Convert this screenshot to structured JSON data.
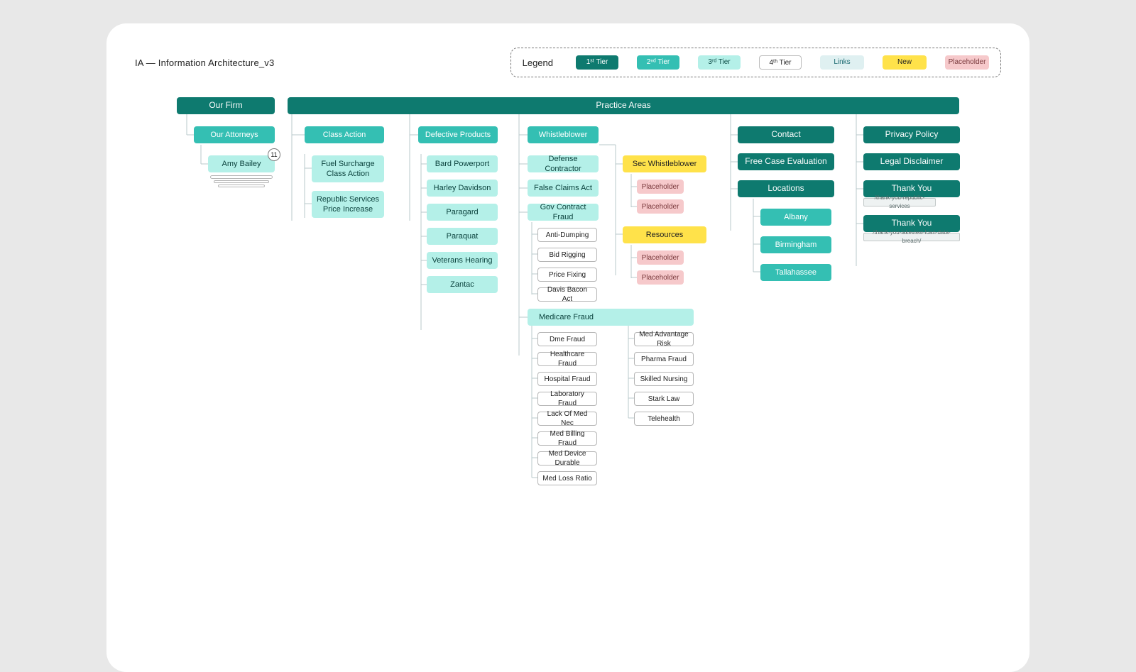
{
  "title": "IA — Information Architecture_v3",
  "legend": {
    "label": "Legend",
    "tier1": "1ˢᵗ Tier",
    "tier2": "2ⁿᵈ Tier",
    "tier3": "3ʳᵈ Tier",
    "tier4": "4ᵗʰ Tier",
    "links": "Links",
    "new": "New",
    "placeholder": "Placeholder"
  },
  "our_firm": "Our Firm",
  "our_attorneys": "Our Attorneys",
  "amy_bailey": "Amy Bailey",
  "amy_count": "11",
  "practice_areas": "Practice Areas",
  "class_action": "Class Action",
  "ca": {
    "fuel": "Fuel Surcharge Class Action",
    "republic": "Republic Services Price Increase"
  },
  "defective": "Defective Products",
  "dp": {
    "bard": "Bard Powerport",
    "harley": "Harley Davidson",
    "paragard": "Paragard",
    "paraquat": "Paraquat",
    "veterans": "Veterans Hearing",
    "zantac": "Zantac"
  },
  "whistle": "Whistleblower",
  "wb": {
    "defcon": "Defense Contractor",
    "fca": "False Claims Act",
    "gov": "Gov Contract Fraud",
    "medicare": "Medicare Fraud"
  },
  "gov": {
    "anti": "Anti-Dumping",
    "bid": "Bid Rigging",
    "price": "Price Fixing",
    "davis": "Davis Bacon Act"
  },
  "sec": "Sec Whistleblower",
  "sec_ph": {
    "a": "Placeholder",
    "b": "Placeholder"
  },
  "resources": "Resources",
  "res_ph": {
    "a": "Placeholder",
    "b": "Placeholder"
  },
  "med": {
    "dme": "Dme Fraud",
    "health": "Healthcare Fraud",
    "hospital": "Hospital Fraud",
    "lab": "Laboratory Fraud",
    "lack": "Lack Of Med Nec",
    "billing": "Med Billing Fraud",
    "device": "Med Device Durable",
    "loss": "Med Loss Ratio",
    "adv": "Med Advantage Risk",
    "pharma": "Pharma Fraud",
    "nursing": "Skilled Nursing",
    "stark": "Stark Law",
    "tele": "Telehealth"
  },
  "contact": "Contact",
  "free_case": "Free Case Evaluation",
  "locations": "Locations",
  "loc": {
    "albany": "Albany",
    "birm": "Birmingham",
    "tall": "Tallahassee"
  },
  "privacy": "Privacy Policy",
  "disclaimer": "Legal Disclaimer",
  "thankyou1": "Thank You",
  "thankyou1_note": "/thank-you-republic-services",
  "thankyou2": "Thank You",
  "thankyou2_note": "/thank-you-lakeview-loan-data-breach/"
}
